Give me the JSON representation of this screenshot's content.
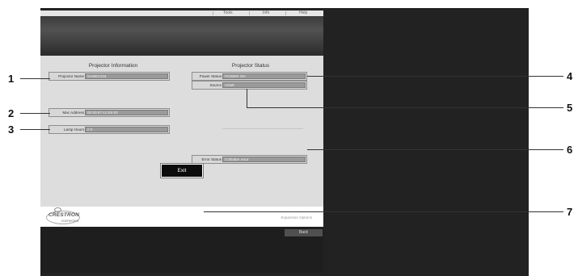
{
  "menu": {
    "tools": "Tools",
    "info": "Info",
    "help": "Help"
  },
  "projector_information": {
    "title": "Projector Information",
    "projector_name": {
      "label": "Projector Name",
      "value": "NAME1234"
    },
    "mac_address": {
      "label": "Mac Address",
      "value": "00:00:97:41:E6:93"
    },
    "lamp_hours": {
      "label": "Lamp Hours",
      "value": "0 h"
    }
  },
  "projector_status": {
    "title": "Projector Status",
    "power_status": {
      "label": "Power Status",
      "value": "POWER ON"
    },
    "source": {
      "label": "Source",
      "value": "HDMI"
    },
    "error_status": {
      "label": "Error Status",
      "value": "0:Shutter error"
    }
  },
  "buttons": {
    "exit": "Exit",
    "back": "Back"
  },
  "footer": {
    "brand": "CRESTRON",
    "brand_sub": "connected",
    "expansion_options": "Expansion Options"
  },
  "callouts": {
    "n1": "1",
    "n2": "2",
    "n3": "3",
    "n4": "4",
    "n5": "5",
    "n6": "6",
    "n7": "7"
  }
}
